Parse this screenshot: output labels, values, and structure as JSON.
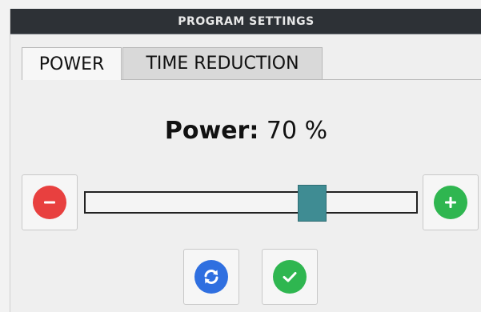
{
  "window": {
    "title": "PROGRAM SETTINGS"
  },
  "tabs": [
    {
      "label": "POWER",
      "active": true
    },
    {
      "label": "TIME REDUCTION",
      "active": false
    }
  ],
  "power": {
    "label": "Power:",
    "value_text": "70 %",
    "value": 70,
    "min": 0,
    "max": 100
  },
  "buttons": {
    "decrease": {
      "icon": "minus-icon",
      "color": "#e8403f"
    },
    "increase": {
      "icon": "plus-icon",
      "color": "#2fb650"
    },
    "reset": {
      "icon": "refresh-icon",
      "color": "#2f6fe0"
    },
    "confirm": {
      "icon": "checkmark-icon",
      "color": "#2fb650"
    }
  },
  "slider": {
    "thumb_color": "#3f8c93"
  }
}
